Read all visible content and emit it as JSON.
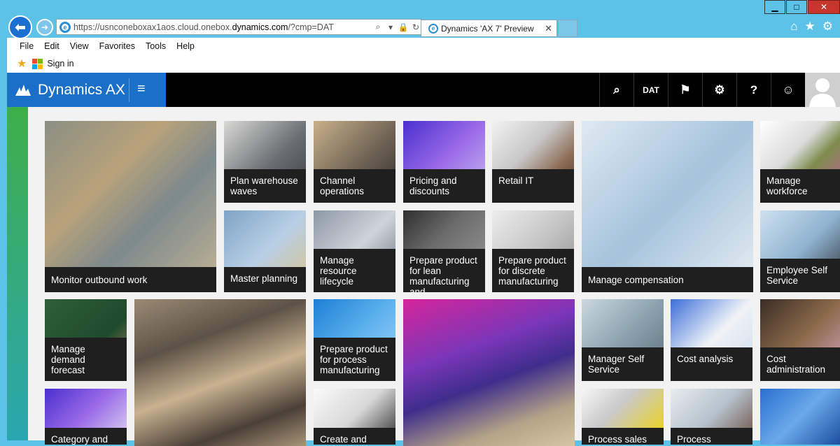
{
  "browser": {
    "url_host": "https://usnconeboxax1aos.cloud.onebox.",
    "url_domain": "dynamics.com",
    "url_path": "/?cmp=DAT",
    "tab_title": "Dynamics 'AX 7' Preview",
    "tab_close": "✕",
    "ie_letter": "e",
    "addr_search": "⌕",
    "addr_dropdown": "▾",
    "addr_lock": "🔒",
    "addr_refresh": "↻",
    "back_glyph": "⬅",
    "forward_glyph": "➜",
    "toolbar_glyphs": [
      "⌂",
      "★",
      "⚙"
    ],
    "window_controls": {
      "minimize": "▁",
      "maximize": "□",
      "close": "✕"
    },
    "menu": [
      "File",
      "Edit",
      "View",
      "Favorites",
      "Tools",
      "Help"
    ],
    "favorites_signin": "Sign in",
    "star_glyph": "★",
    "ms_logo_colors": [
      "#f25022",
      "#7fba00",
      "#00a4ef",
      "#ffb900"
    ]
  },
  "app": {
    "title": "Dynamics AX",
    "menu_glyph": "≡",
    "company": "DAT",
    "icons": [
      "search-icon",
      "company-label",
      "flag-icon",
      "gear-icon",
      "help-icon",
      "smiley-icon"
    ],
    "icon_glyphs": [
      "⌕",
      "DAT",
      "⚑",
      "⚙",
      "?",
      "☺"
    ],
    "brand_color": "#1a70c8"
  },
  "tiles": [
    {
      "label": "Monitor outbound work",
      "bg": "linear-gradient(135deg,#8a8f84 0%,#b9a27a 35%,#7d8a8c 60%,#c4b497 100%)"
    },
    {
      "label": "Plan warehouse waves",
      "bg": "linear-gradient(135deg,#d9d9d6,#6a6e72 55%,#3a3c40)"
    },
    {
      "label": "Channel operations",
      "bg": "linear-gradient(135deg,#c8b089,#6f6355 55%,#2e2c2a)"
    },
    {
      "label": "Pricing and discounts",
      "bg": "linear-gradient(135deg,#4a2fd0,#9c6ce8 50%,#c9c3ee)"
    },
    {
      "label": "Retail IT",
      "bg": "linear-gradient(135deg,#f2f2f2,#c8c8c8 40%,#8a6a52 70%,#3f2b22)"
    },
    {
      "label": "Manage compensation",
      "bg": "linear-gradient(135deg,#dfe9f2,#a5c3dc 50%,#e8eef3)"
    },
    {
      "label": "Manage workforce",
      "bg": "linear-gradient(135deg,#ffffff,#dcdcdc 40%,#7e8c4e 60%,#c35b9b)"
    },
    {
      "label": "Master planning",
      "bg": "linear-gradient(135deg,#7ea4c4,#b8cfe6 50%,#d7c28c)"
    },
    {
      "label": "Manage resource lifecycle",
      "bg": "linear-gradient(135deg,#8c98a6,#d0d4da 50%,#606a75)"
    },
    {
      "label": "Prepare product for lean manufacturing and replenishment",
      "bg": "linear-gradient(135deg,#2f2f2f,#6c6c6c 40%,#9e9e9e)"
    },
    {
      "label": "Prepare product for discrete manufacturing",
      "bg": "linear-gradient(135deg,#ededed,#c4c4c4 50%,#8b8b8b)"
    },
    {
      "label": "Employee Self Service",
      "bg": "linear-gradient(135deg,#cfe1f0,#8fb3d0 50%,#2b2f33)"
    },
    {
      "label": "Manage demand forecast",
      "bg": "linear-gradient(135deg,#2f5f3c,#1d4a2b 60%,#b88a6a)"
    },
    {
      "label": "",
      "bg": "linear-gradient(160deg,#9a8a74 0%,#5d5247 30%,#c8b290 55%,#4b4038 80%,#a89478 100%)"
    },
    {
      "label": "Prepare product for process manufacturing",
      "bg": "linear-gradient(135deg,#1e7fd6,#5eb2ee 50%,#a9d7f6)"
    },
    {
      "label": "",
      "bg": "linear-gradient(160deg,#d6259a 0%,#7a36b8 35%,#3f2d8c 55%,#b4a487 80%,#d6c6a6 100%)"
    },
    {
      "label": "Manager Self Service",
      "bg": "linear-gradient(135deg,#cbd8df,#8aa1ad 50%,#5a6d78)"
    },
    {
      "label": "Cost analysis",
      "bg": "linear-gradient(135deg,#3b6fd9,#f0f3f7 50%,#c9d9ea)"
    },
    {
      "label": "Cost administration",
      "bg": "linear-gradient(135deg,#3a2c26,#8b6a4a 50%,#d7a6c6)"
    },
    {
      "label": "Category and",
      "bg": "linear-gradient(135deg,#4a2fd0,#9c6ce8 50%,#e0dbf3)"
    },
    {
      "label": "Create and maintain",
      "bg": "linear-gradient(135deg,#fafafa,#d8d8d8 50%,#2c2c2c)"
    },
    {
      "label": "Process sales",
      "bg": "linear-gradient(135deg,#f6f6f6,#c9c9c9 40%,#f2d400)"
    },
    {
      "label": "Process receipts",
      "bg": "linear-gradient(135deg,#e9ecef,#b5c2cd 50%,#6b4a3a)"
    },
    {
      "label": "",
      "bg": "linear-gradient(135deg,#2a6fd0,#6aa9ea 50%,#1d4fa0)"
    }
  ]
}
